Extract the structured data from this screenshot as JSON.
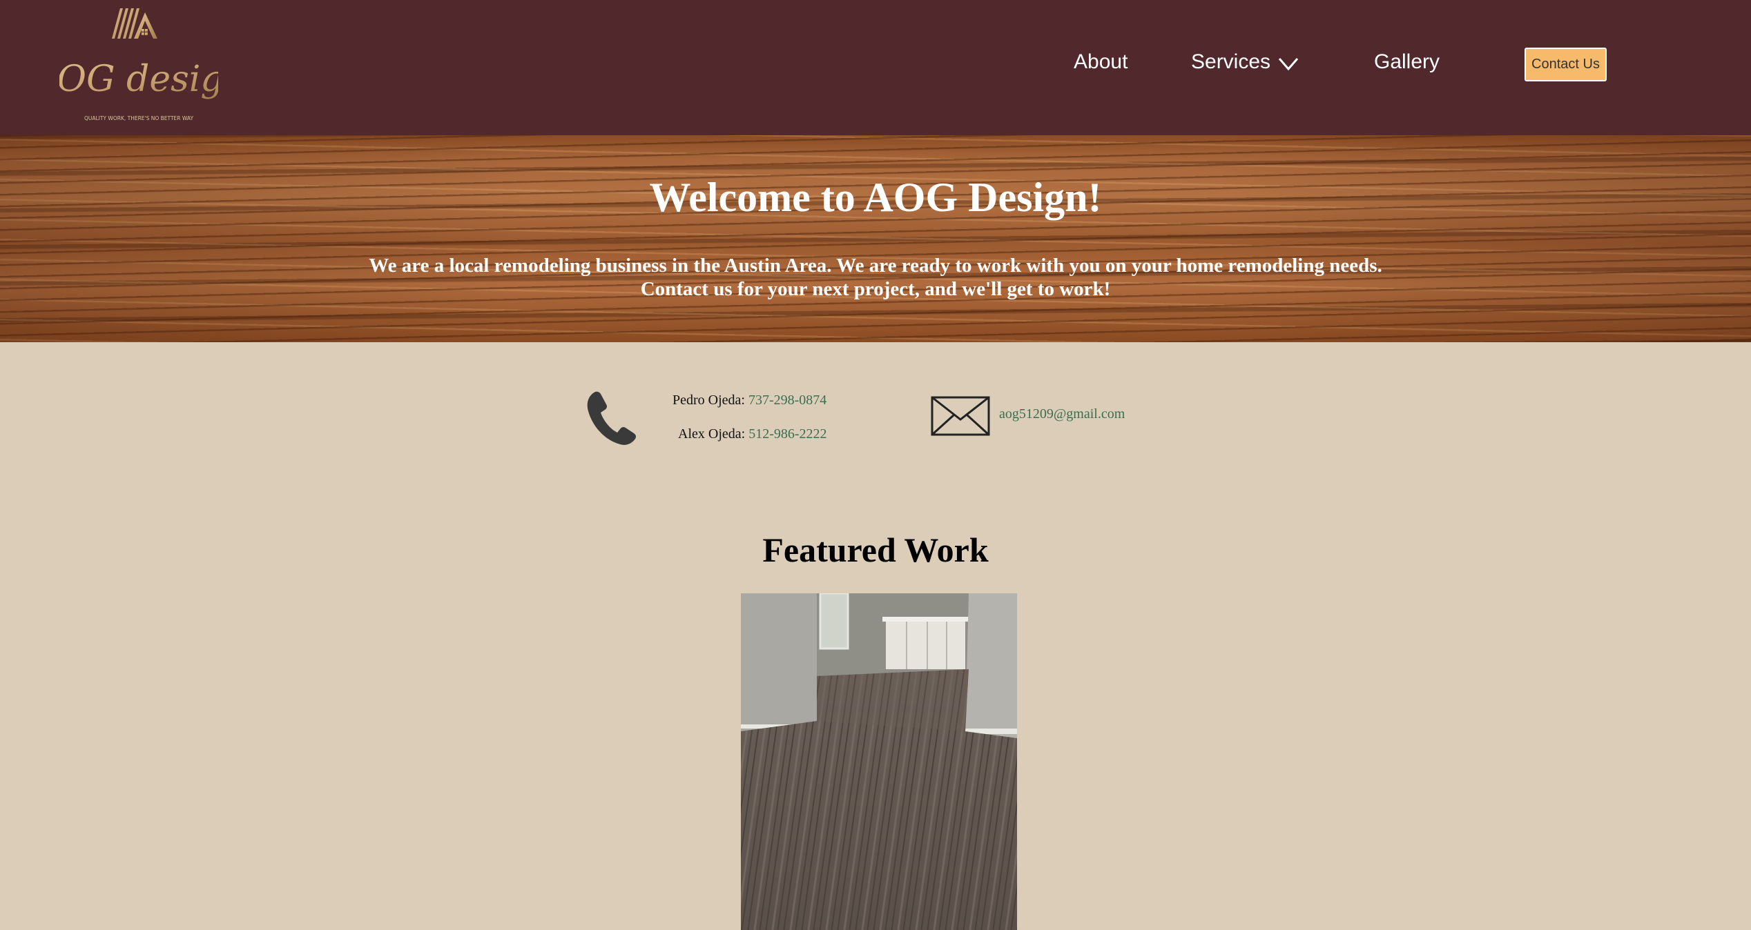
{
  "header": {
    "logo": {
      "text": "AOG design",
      "tagline": "QUALITY WORK, THERE'S NO BETTER WAY"
    },
    "nav": {
      "about": "About",
      "services": "Services",
      "gallery": "Gallery"
    },
    "contact_button": "Contact Us"
  },
  "hero": {
    "title": "Welcome to AOG Design!",
    "line1": "We are a local remodeling business in the Austin Area. We are ready to work with you on your home remodeling needs.",
    "line2": "Contact us for your next project, and we'll get to work!"
  },
  "contact": {
    "phones": [
      {
        "name": "Pedro Ojeda:",
        "number": "737-298-0874"
      },
      {
        "name": "Alex Ojeda:",
        "number": "512-986-2222"
      }
    ],
    "email": "aog51209@gmail.com"
  },
  "featured": {
    "title": "Featured Work"
  },
  "colors": {
    "header_bg": "#51282b",
    "page_bg": "#dbcdb8",
    "button_bg": "#f7b96a",
    "link": "#3b6e50",
    "logo_gold": "#c9a472"
  },
  "icons": [
    "logo-roof-icon",
    "chevron-down-icon",
    "phone-icon",
    "mail-icon"
  ]
}
